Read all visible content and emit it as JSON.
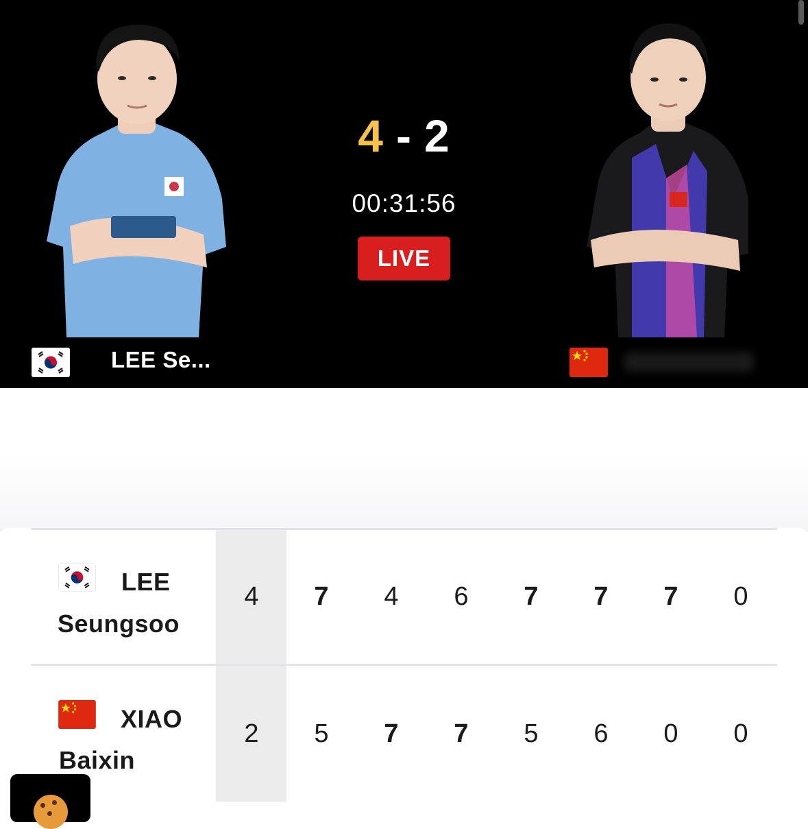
{
  "header": {
    "score_a": "4",
    "score_sep": "-",
    "score_b": "2",
    "clock": "00:31:56",
    "live_label": "LIVE",
    "player_left_short": "LEE Se...",
    "player_left_flag": "south-korea-flag",
    "player_right_flag": "china-flag"
  },
  "colors": {
    "score_highlight": "#f4c14a",
    "live_bg": "#d81e1e",
    "games_column_bg": "#ebebeb"
  },
  "scoreboard": {
    "rows": [
      {
        "first": "LEE",
        "last": "Seungsoo",
        "flag": "south-korea-flag",
        "games": "4",
        "sets": [
          "7",
          "4",
          "6",
          "7",
          "7",
          "7",
          "0"
        ]
      },
      {
        "first": "XIAO",
        "last": "Baixin",
        "flag": "china-flag",
        "games": "2",
        "sets": [
          "5",
          "7",
          "7",
          "5",
          "6",
          "0",
          "0"
        ]
      }
    ]
  }
}
